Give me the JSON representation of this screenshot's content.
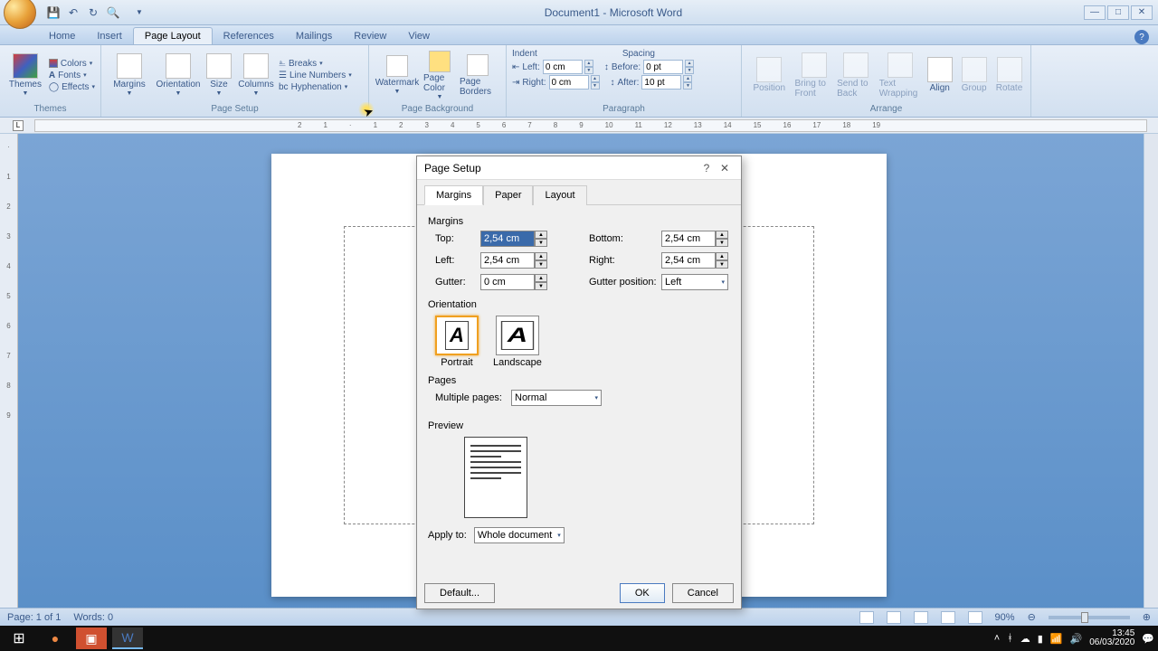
{
  "window": {
    "title": "Document1 - Microsoft Word"
  },
  "tabs": {
    "home": "Home",
    "insert": "Insert",
    "pagelayout": "Page Layout",
    "references": "References",
    "mailings": "Mailings",
    "review": "Review",
    "view": "View"
  },
  "ribbon": {
    "themes": {
      "label": "Themes",
      "themes": "Themes",
      "colors": "Colors",
      "fonts": "Fonts",
      "effects": "Effects"
    },
    "pagesetup": {
      "label": "Page Setup",
      "margins": "Margins",
      "orientation": "Orientation",
      "size": "Size",
      "columns": "Columns",
      "breaks": "Breaks",
      "linenumbers": "Line Numbers",
      "hyphenation": "Hyphenation"
    },
    "pagebg": {
      "label": "Page Background",
      "watermark": "Watermark",
      "pagecolor": "Page Color",
      "pageborders": "Page Borders"
    },
    "paragraph": {
      "label": "Paragraph",
      "indent": "Indent",
      "spacing": "Spacing",
      "left": "Left:",
      "right": "Right:",
      "before": "Before:",
      "after": "After:",
      "left_val": "0 cm",
      "right_val": "0 cm",
      "before_val": "0 pt",
      "after_val": "10 pt"
    },
    "arrange": {
      "label": "Arrange",
      "position": "Position",
      "bringtofront": "Bring to Front",
      "sendtoback": "Send to Back",
      "textwrapping": "Text Wrapping",
      "align": "Align",
      "group": "Group",
      "rotate": "Rotate"
    }
  },
  "dialog": {
    "title": "Page Setup",
    "tabs": {
      "margins": "Margins",
      "paper": "Paper",
      "layout": "Layout"
    },
    "margins": {
      "section": "Margins",
      "top": "Top:",
      "top_val": "2,54 cm",
      "bottom": "Bottom:",
      "bottom_val": "2,54 cm",
      "left": "Left:",
      "left_val": "2,54 cm",
      "right": "Right:",
      "right_val": "2,54 cm",
      "gutter": "Gutter:",
      "gutter_val": "0 cm",
      "gutterpos": "Gutter position:",
      "gutterpos_val": "Left"
    },
    "orientation": {
      "section": "Orientation",
      "portrait": "Portrait",
      "landscape": "Landscape"
    },
    "pages": {
      "section": "Pages",
      "multiple": "Multiple pages:",
      "multiple_val": "Normal"
    },
    "preview": {
      "section": "Preview"
    },
    "apply": {
      "label": "Apply to:",
      "val": "Whole document"
    },
    "buttons": {
      "default": "Default...",
      "ok": "OK",
      "cancel": "Cancel"
    }
  },
  "status": {
    "page": "Page: 1 of 1",
    "words": "Words: 0",
    "zoom": "90%"
  },
  "taskbar": {
    "time": "13:45",
    "date": "06/03/2020"
  }
}
